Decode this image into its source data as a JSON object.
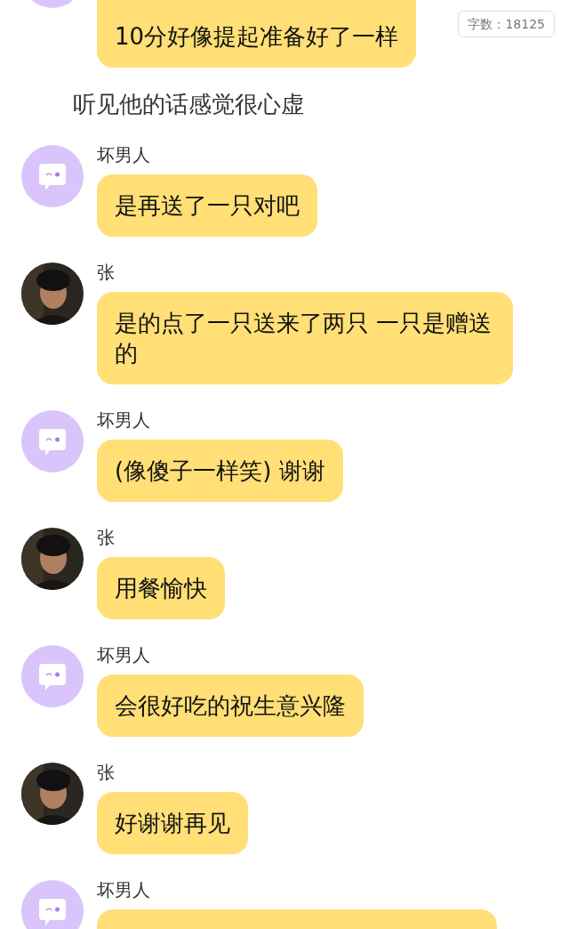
{
  "word_count": "字数：18125",
  "items": [
    {
      "kind": "bot_message",
      "text": "10分好像提起准备好了一样"
    },
    {
      "kind": "narration",
      "text": "听见他的话感觉很心虚"
    },
    {
      "kind": "bot_message",
      "sender": "坏男人",
      "text": "是再送了一只对吧"
    },
    {
      "kind": "user_message",
      "sender": "张",
      "text": "是的点了一只送来了两只 一只是赠送的"
    },
    {
      "kind": "bot_message",
      "sender": "坏男人",
      "text": "(像傻子一样笑) 谢谢"
    },
    {
      "kind": "user_message",
      "sender": "张",
      "text": "用餐愉快"
    },
    {
      "kind": "bot_message",
      "sender": "坏男人",
      "text": "会很好吃的祝生意兴隆"
    },
    {
      "kind": "user_message",
      "sender": "张",
      "text": "好谢谢再见"
    },
    {
      "kind": "bot_message",
      "sender": "坏男人"
    }
  ]
}
